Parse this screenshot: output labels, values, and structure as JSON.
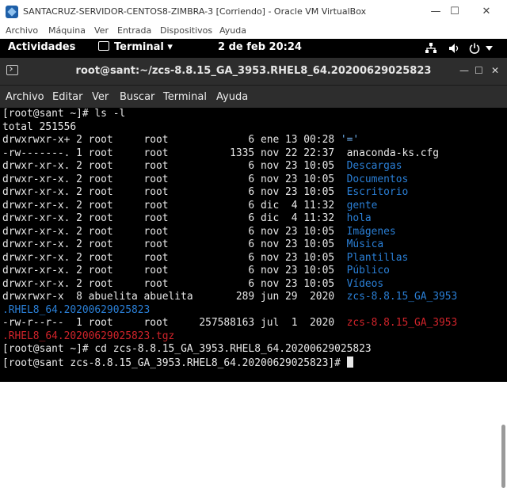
{
  "vbox": {
    "title": "SANTACRUZ-SERVIDOR-CENTOS8-ZIMBRA-3 [Corriendo] - Oracle VM VirtualBox",
    "min": "—",
    "max": "☐",
    "close": "✕",
    "menu": [
      "Archivo",
      "Máquina",
      "Ver",
      "Entrada",
      "Dispositivos",
      "Ayuda"
    ]
  },
  "gnome": {
    "activities": "Actividades",
    "terminal": "Terminal ▾",
    "clock": "2 de feb  20:24",
    "net_icon": "network-icon",
    "volume_icon": "volume-icon",
    "power_icon": "power-icon"
  },
  "terminal": {
    "title": "root@sant:~/zcs-8.8.15_GA_3953.RHEL8_64.20200629025823",
    "menu": [
      "Archivo",
      "Editar",
      "Ver",
      "Buscar",
      "Terminal",
      "Ayuda"
    ],
    "lines": [
      {
        "t": "[root@sant ~]# ls -l"
      },
      {
        "t": "total 251556"
      },
      {
        "t": "drwxrwxr-x+ 2 root     root             6 ene 13 00:28 ",
        "s": "'='",
        "c": "c-ltblue"
      },
      {
        "t": "-rw-------. 1 root     root          1335 nov 22 22:37  ",
        "s": "anaconda-ks.cfg",
        "c": ""
      },
      {
        "t": "drwxr-xr-x. 2 root     root             6 nov 23 10:05  ",
        "s": "Descargas",
        "c": "c-blue"
      },
      {
        "t": "drwxr-xr-x. 2 root     root             6 nov 23 10:05  ",
        "s": "Documentos",
        "c": "c-blue"
      },
      {
        "t": "drwxr-xr-x. 2 root     root             6 nov 23 10:05  ",
        "s": "Escritorio",
        "c": "c-blue"
      },
      {
        "t": "drwxr-xr-x. 2 root     root             6 dic  4 11:32  ",
        "s": "gente",
        "c": "c-blue"
      },
      {
        "t": "drwxr-xr-x. 2 root     root             6 dic  4 11:32  ",
        "s": "hola",
        "c": "c-blue"
      },
      {
        "t": "drwxr-xr-x. 2 root     root             6 nov 23 10:05  ",
        "s": "Imágenes",
        "c": "c-blue"
      },
      {
        "t": "drwxr-xr-x. 2 root     root             6 nov 23 10:05  ",
        "s": "Música",
        "c": "c-blue"
      },
      {
        "t": "drwxr-xr-x. 2 root     root             6 nov 23 10:05  ",
        "s": "Plantillas",
        "c": "c-blue"
      },
      {
        "t": "drwxr-xr-x. 2 root     root             6 nov 23 10:05  ",
        "s": "Público",
        "c": "c-blue"
      },
      {
        "t": "drwxr-xr-x. 2 root     root             6 nov 23 10:05  ",
        "s": "Vídeos",
        "c": "c-blue"
      },
      {
        "t": "drwxrwxr-x  8 abuelita abuelita       289 jun 29  2020  ",
        "s": "zcs-8.8.15_GA_3953",
        "c": "c-blue"
      },
      {
        "t": "",
        "s": ".RHEL8_64.20200629025823",
        "c": "c-blue"
      },
      {
        "t": "-rw-r--r--  1 root     root     257588163 jul  1  2020  ",
        "s": "zcs-8.8.15_GA_3953",
        "c": "c-red"
      },
      {
        "t": "",
        "s": ".RHEL8_64.20200629025823.tgz",
        "c": "c-red"
      },
      {
        "t": "[root@sant ~]# cd zcs-8.8.15_GA_3953.RHEL8_64.20200629025823"
      },
      {
        "t": "[root@sant zcs-8.8.15_GA_3953.RHEL8_64.20200629025823]# ",
        "cursor": true
      }
    ]
  }
}
